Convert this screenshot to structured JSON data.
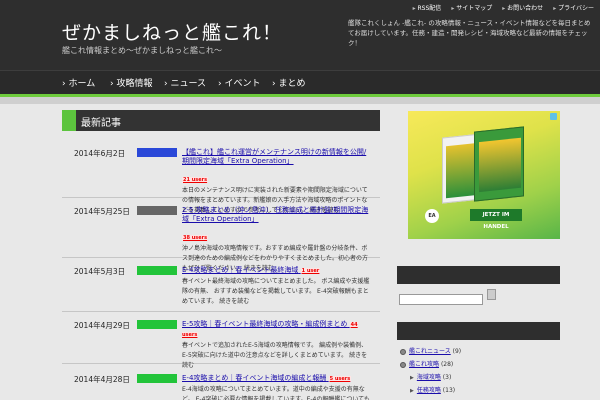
{
  "header": {
    "site_title": "ぜかましねっと艦これ！",
    "site_subtitle": "艦これ情報まとめ〜ぜかましねっと艦これ〜",
    "description": "艦隊これくしょん -艦これ- の攻略情報・ニュース・イベント情報などを毎日まとめてお届けしています。任務・建造・開発レシピ・海域攻略など最新の情報をチェック！",
    "top_links": [
      "RSS配信",
      "サイトマップ",
      "お問い合わせ",
      "プライバシー"
    ]
  },
  "nav": {
    "items": [
      "ホーム",
      "攻略情報",
      "ニュース",
      "イベント",
      "まとめ"
    ]
  },
  "main": {
    "section_title": "最新記事",
    "posts": [
      {
        "date": "2014年6月2日",
        "cat_color": "#2a48d8",
        "title": "【艦これ】艦これ運営がメンテナンス明けの新情報を公開/期間限定海域「Extra Operation」",
        "users": "21 users",
        "excerpt": "本日のメンテナンス明けに実装された新要素や期間限定海域についての情報をまとめています。新艦娘の入手方法や海域攻略のポイントなどを掲載していますので参考にしてください。 続きを読む"
      },
      {
        "date": "2014年5月25日",
        "cat_color": "#666666",
        "title": "2-5 攻略まとめ（沖ノ島沖） 任務編成と羅針盤/期間限定海域「Extra Operation」",
        "users": "38 users",
        "excerpt": "沖ノ島沖海域の攻略情報です。おすすめ編成や羅針盤の分岐条件、ボス到達のための編成例などをわかりやすくまとめました。初心者の方もぜひご覧ください。 続きを読む"
      },
      {
        "date": "2014年5月3日",
        "cat_color": "#22c43a",
        "title": "E-4攻略まとめ｜春イベント最終海域",
        "users": "1 user",
        "excerpt": "春イベント最終海域の攻略についてまとめました。 ボス編成や支援艦隊の有無、 おすすめ装備などを掲載しています。 E-4突破報酬もまとめています。 続きを読む"
      },
      {
        "date": "2014年4月29日",
        "cat_color": "#22c43a",
        "title": "E-5攻略｜春イベント最終海域の攻略・編成例まとめ",
        "users": "44 users",
        "excerpt": "春イベントで追加されたE-5海域の攻略情報です。 編成例や装備例、 E-5突破に向けた道中の注意点などを詳しくまとめています。 続きを読む"
      },
      {
        "date": "2014年4月28日",
        "cat_color": "#22c43a",
        "title": "E-4攻略まとめ｜春イベント海域の編成と報酬",
        "users": "5 users",
        "excerpt": "E-4海域の攻略についてまとめています。道中の編成や支援の有無など。 E-4突破に必要な情報を掲載しています。E-4の報酬艦についてもあわせてご紹介します。"
      }
    ]
  },
  "sidebar": {
    "ad": {
      "cta": "JETZT IM HANDEL",
      "brand": "EA"
    },
    "search_placeholder": "",
    "categories": [
      {
        "name": "艦これニュース",
        "count": "(9)"
      },
      {
        "name": "艦これ攻略",
        "count": "(28)"
      },
      {
        "name": "海域攻略",
        "count": "(3)"
      },
      {
        "name": "任務攻略",
        "count": "(13)"
      }
    ]
  },
  "colors": {
    "accent": "#5cc43e",
    "header_bg": "#2e2e2e",
    "link": "#1a0dab"
  }
}
